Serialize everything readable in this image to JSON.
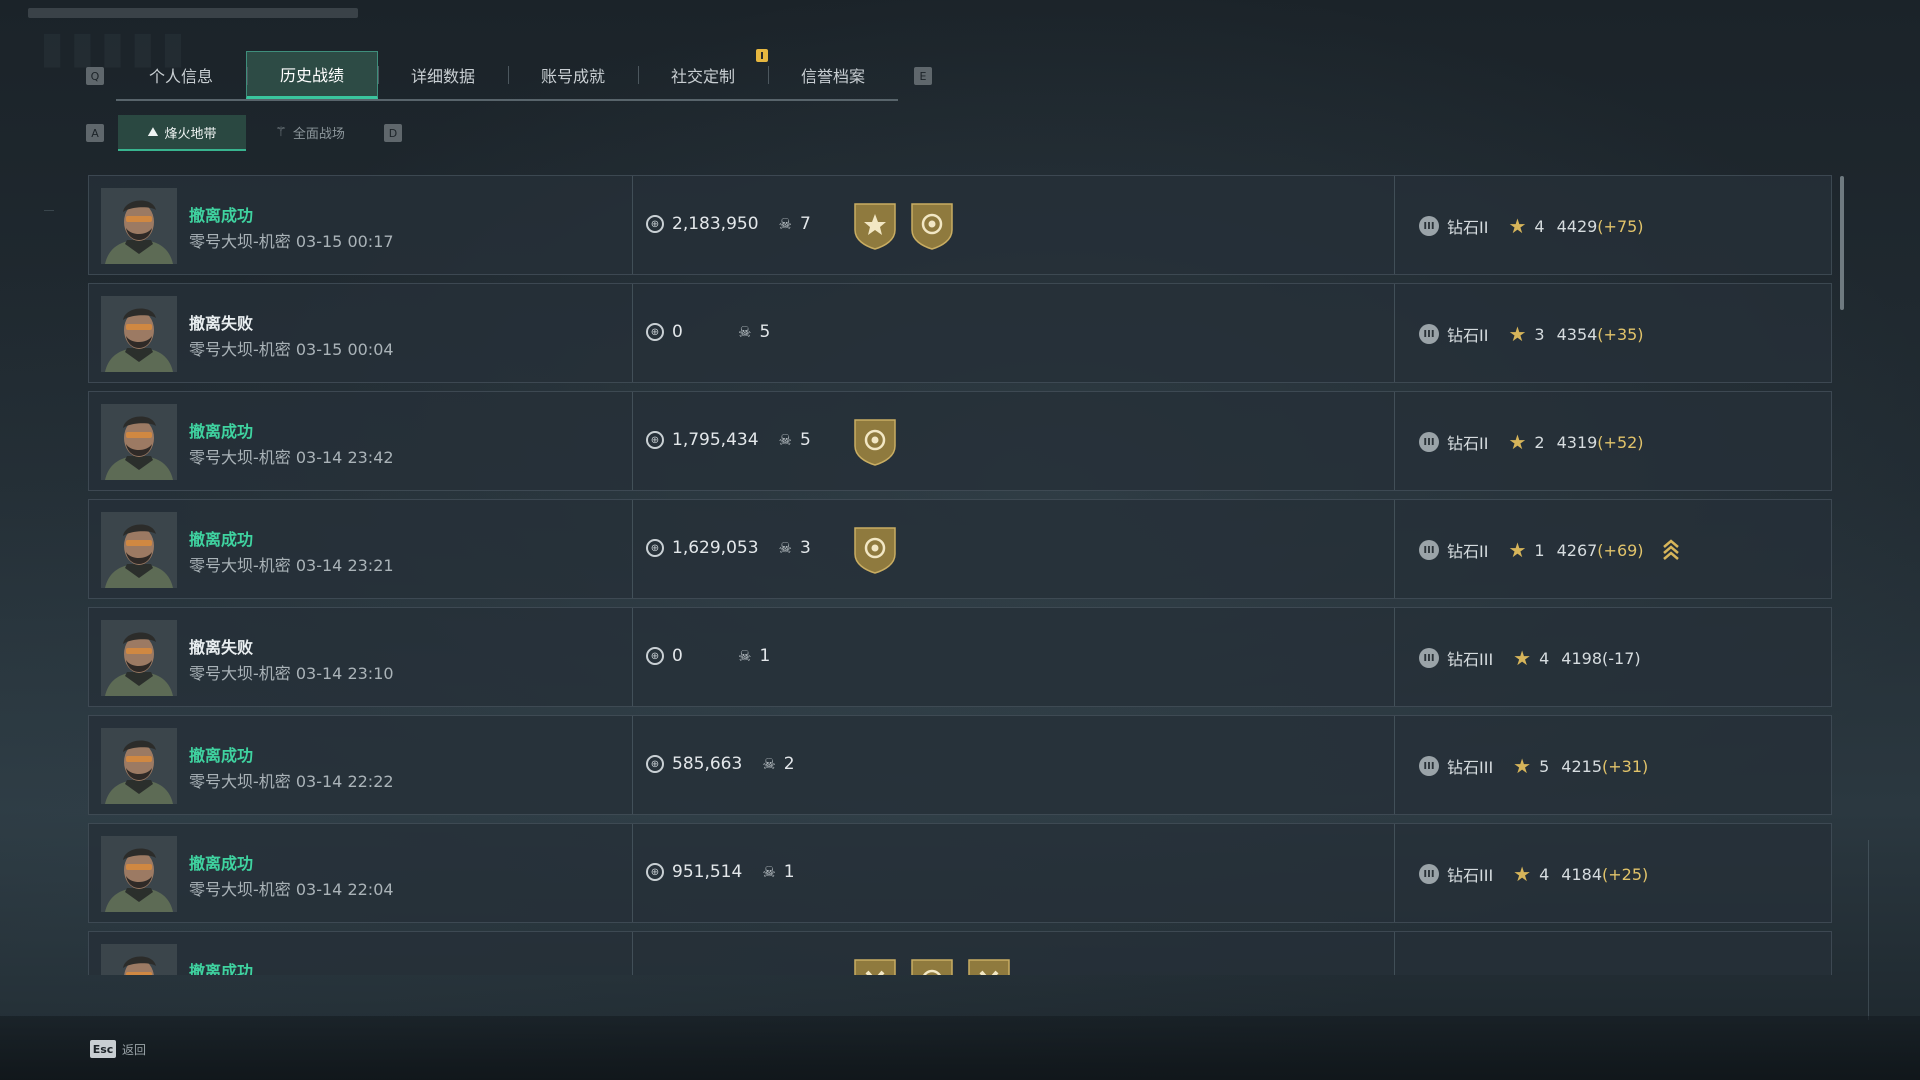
{
  "top_tabs": {
    "left_key": "Q",
    "right_key": "E",
    "items": [
      {
        "label": "个人信息"
      },
      {
        "label": "历史战绩"
      },
      {
        "label": "详细数据"
      },
      {
        "label": "账号成就"
      },
      {
        "label": "社交定制"
      },
      {
        "label": "信誉档案"
      }
    ],
    "active_index": 1,
    "notification_tab_index": 4
  },
  "sub_tabs": {
    "left_key": "A",
    "right_key": "D",
    "items": [
      {
        "label": "烽火地带",
        "icon": "mountain-icon"
      },
      {
        "label": "全面战场",
        "icon": "trident-icon"
      }
    ],
    "active_index": 0
  },
  "colors": {
    "success": "#3fd3a0",
    "accent": "#3ac59e",
    "gold": "#d7b55a",
    "badge": "#8f7a3e"
  },
  "matches": [
    {
      "status": "撤离成功",
      "success": true,
      "meta": "零号大坝-机密 03-15 00:17",
      "money": "2,183,950",
      "kills": "7",
      "badges": [
        "star-badge-icon",
        "medal-badge-icon"
      ],
      "rank": "钻石II",
      "stars": "4",
      "score": "4429",
      "delta": "(+75)",
      "promo": false
    },
    {
      "status": "撤离失败",
      "success": false,
      "meta": "零号大坝-机密 03-15 00:04",
      "money": "0",
      "kills": "5",
      "badges": [],
      "rank": "钻石II",
      "stars": "3",
      "score": "4354",
      "delta": "(+35)",
      "promo": false
    },
    {
      "status": "撤离成功",
      "success": true,
      "meta": "零号大坝-机密 03-14 23:42",
      "money": "1,795,434",
      "kills": "5",
      "badges": [
        "medal-badge-icon"
      ],
      "rank": "钻石II",
      "stars": "2",
      "score": "4319",
      "delta": "(+52)",
      "promo": false
    },
    {
      "status": "撤离成功",
      "success": true,
      "meta": "零号大坝-机密 03-14 23:21",
      "money": "1,629,053",
      "kills": "3",
      "badges": [
        "medal-badge-icon"
      ],
      "rank": "钻石II",
      "stars": "1",
      "score": "4267",
      "delta": "(+69)",
      "promo": true
    },
    {
      "status": "撤离失败",
      "success": false,
      "meta": "零号大坝-机密 03-14 23:10",
      "money": "0",
      "kills": "1",
      "badges": [],
      "rank": "钻石III",
      "stars": "4",
      "score": "4198",
      "delta": "(-17)",
      "promo": false
    },
    {
      "status": "撤离成功",
      "success": true,
      "meta": "零号大坝-机密 03-14 22:22",
      "money": "585,663",
      "kills": "2",
      "badges": [],
      "rank": "钻石III",
      "stars": "5",
      "score": "4215",
      "delta": "(+31)",
      "promo": false
    },
    {
      "status": "撤离成功",
      "success": true,
      "meta": "零号大坝-机密 03-14 22:04",
      "money": "951,514",
      "kills": "1",
      "badges": [],
      "rank": "钻石III",
      "stars": "4",
      "score": "4184",
      "delta": "(+25)",
      "promo": false
    },
    {
      "status": "撤离成功",
      "success": true,
      "meta": "",
      "money": "",
      "kills": "",
      "badges": [
        "cross-badge-icon",
        "medal-badge-icon",
        "cross-badge-icon"
      ],
      "rank": "",
      "stars": "",
      "score": "",
      "delta": "",
      "promo": false
    }
  ],
  "footer": {
    "esc_key": "Esc",
    "esc_label": "返回"
  }
}
